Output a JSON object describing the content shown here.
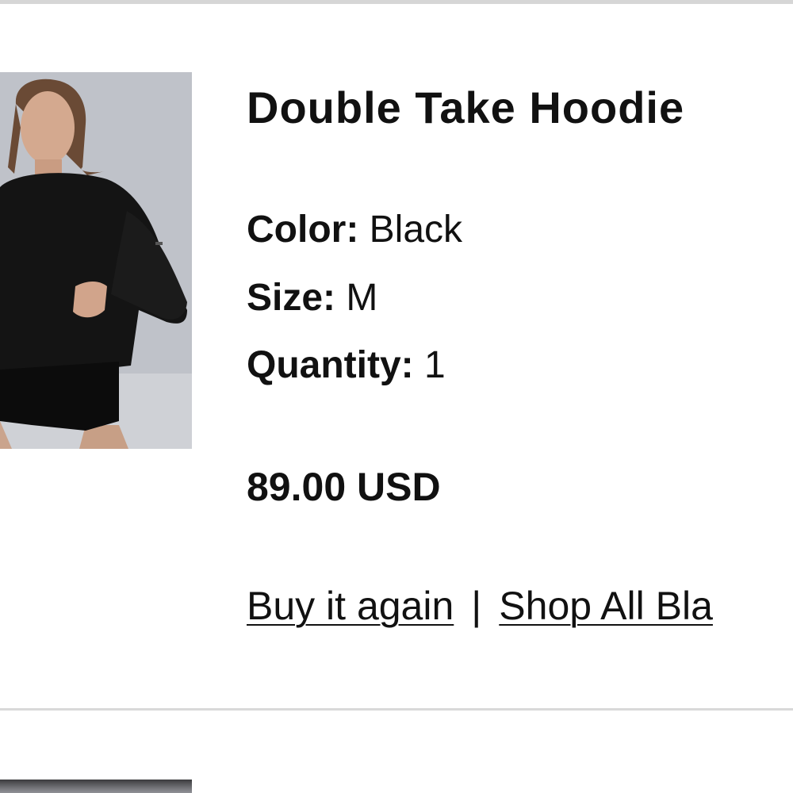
{
  "item": {
    "name": "Double Take Hoodie",
    "image_alt": "model wearing black hoodie and black shorts",
    "attributes": [
      {
        "label": "Color:",
        "value": "Black"
      },
      {
        "label": "Size:",
        "value": "M"
      },
      {
        "label": "Quantity:",
        "value": "1"
      }
    ],
    "price": "89.00 USD",
    "actions": {
      "buy_again": "Buy it again",
      "separator": "|",
      "shop_all": "Shop All Bla"
    }
  }
}
